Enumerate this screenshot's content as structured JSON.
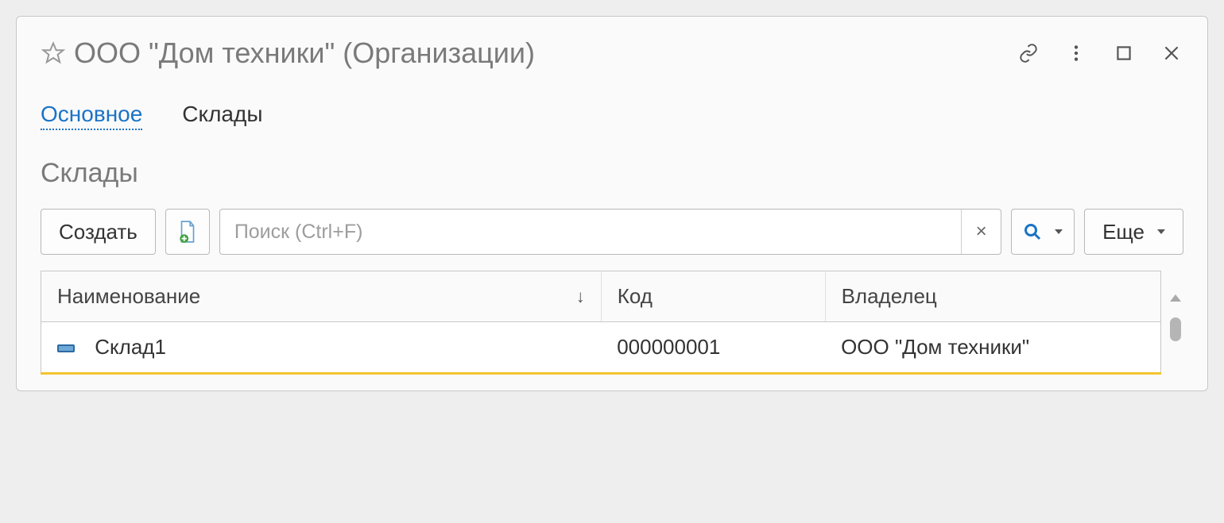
{
  "window": {
    "title": "ООО \"Дом техники\" (Организации)"
  },
  "tabs": {
    "main": "Основное",
    "warehouses": "Склады"
  },
  "section": {
    "title": "Склады"
  },
  "toolbar": {
    "create_label": "Создать",
    "more_label": "Еще",
    "search_placeholder": "Поиск (Ctrl+F)"
  },
  "table": {
    "columns": {
      "name": "Наименование",
      "code": "Код",
      "owner": "Владелец"
    },
    "rows": [
      {
        "name": "Склад1",
        "code": "000000001",
        "owner": "ООО \"Дом техники\""
      }
    ]
  }
}
